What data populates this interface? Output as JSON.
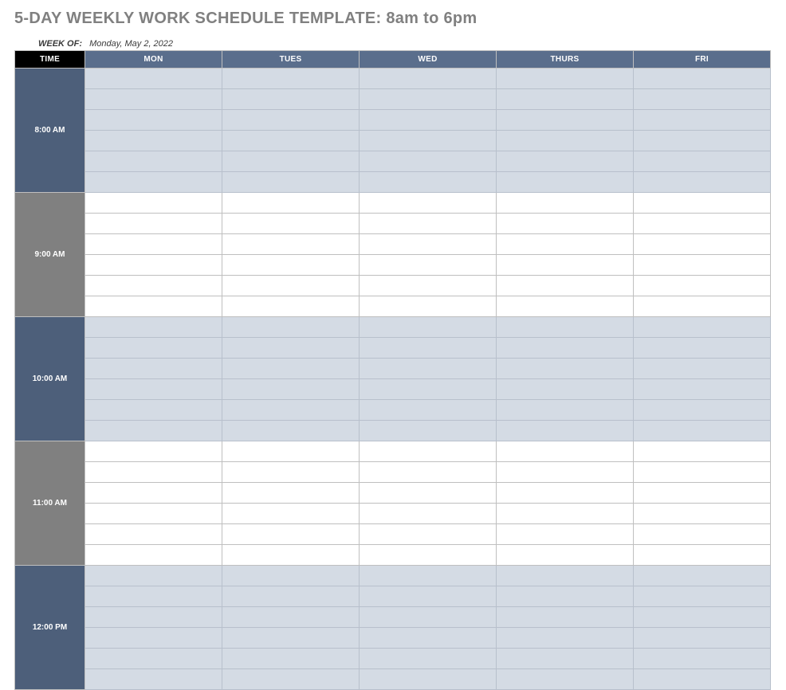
{
  "title": "5-DAY WEEKLY WORK SCHEDULE TEMPLATE: 8am to 6pm",
  "week_of_label": "WEEK OF:",
  "week_of_value": "Monday, May 2, 2022",
  "columns": {
    "time": "TIME",
    "days": [
      "MON",
      "TUES",
      "WED",
      "THURS",
      "FRI"
    ]
  },
  "time_blocks": [
    {
      "label": "8:00 AM",
      "style": "navy",
      "rows": 6
    },
    {
      "label": "9:00 AM",
      "style": "gray",
      "rows": 6
    },
    {
      "label": "10:00 AM",
      "style": "navy",
      "rows": 6
    },
    {
      "label": "11:00 AM",
      "style": "gray",
      "rows": 6
    },
    {
      "label": "12:00 PM",
      "style": "navy",
      "rows": 6
    }
  ]
}
